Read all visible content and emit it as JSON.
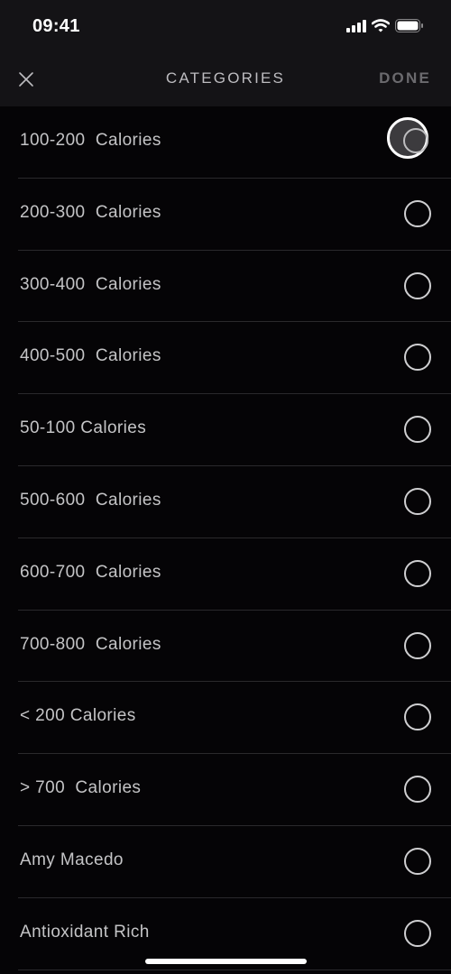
{
  "status_bar": {
    "time": "09:41",
    "icons": [
      "signal-icon",
      "wifi-icon",
      "battery-icon"
    ]
  },
  "header": {
    "close_icon": "close-icon",
    "title": "CATEGORIES",
    "done_label": "DONE"
  },
  "categories": [
    {
      "label": "100-200  Calories",
      "selected": true
    },
    {
      "label": "200-300  Calories",
      "selected": false
    },
    {
      "label": "300-400  Calories",
      "selected": false
    },
    {
      "label": "400-500  Calories",
      "selected": false
    },
    {
      "label": "50-100 Calories",
      "selected": false
    },
    {
      "label": "500-600  Calories",
      "selected": false
    },
    {
      "label": "600-700  Calories",
      "selected": false
    },
    {
      "label": "700-800  Calories",
      "selected": false
    },
    {
      "label": "< 200 Calories",
      "selected": false
    },
    {
      "label": "> 700  Calories",
      "selected": false
    },
    {
      "label": "Amy Macedo",
      "selected": false
    },
    {
      "label": "Antioxidant Rich",
      "selected": false
    }
  ]
}
